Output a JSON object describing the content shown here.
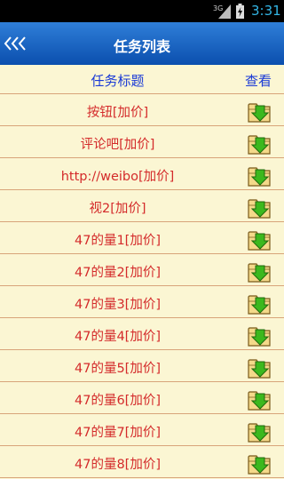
{
  "status_bar": {
    "network": "3G",
    "time": "3:31",
    "signal_icon": "signal-icon",
    "battery_icon": "battery-charging-icon"
  },
  "title_bar": {
    "back_label": "<<<",
    "title": "任务列表"
  },
  "list_header": {
    "title_col": "任务标题",
    "view_col": "查看"
  },
  "tasks": [
    {
      "title": "按钮[加价]",
      "icon": "folder-download-icon"
    },
    {
      "title": "评论吧[加价]",
      "icon": "folder-download-icon"
    },
    {
      "title": "http://weibo[加价]",
      "icon": "folder-download-icon"
    },
    {
      "title": "视2[加价]",
      "icon": "folder-download-icon"
    },
    {
      "title": "47的量1[加价]",
      "icon": "folder-download-icon"
    },
    {
      "title": "47的量2[加价]",
      "icon": "folder-download-icon"
    },
    {
      "title": "47的量3[加价]",
      "icon": "folder-download-icon"
    },
    {
      "title": "47的量4[加价]",
      "icon": "folder-download-icon"
    },
    {
      "title": "47的量5[加价]",
      "icon": "folder-download-icon"
    },
    {
      "title": "47的量6[加价]",
      "icon": "folder-download-icon"
    },
    {
      "title": "47的量7[加价]",
      "icon": "folder-download-icon"
    },
    {
      "title": "47的量8[加价]",
      "icon": "folder-download-icon"
    }
  ],
  "colors": {
    "title_bar": "#1560c4",
    "background": "#fbf6d3",
    "header_text": "#1a3ad6",
    "row_text": "#d42b2b",
    "divider": "#d8a47a",
    "icon_arrow": "#3cb81e"
  }
}
